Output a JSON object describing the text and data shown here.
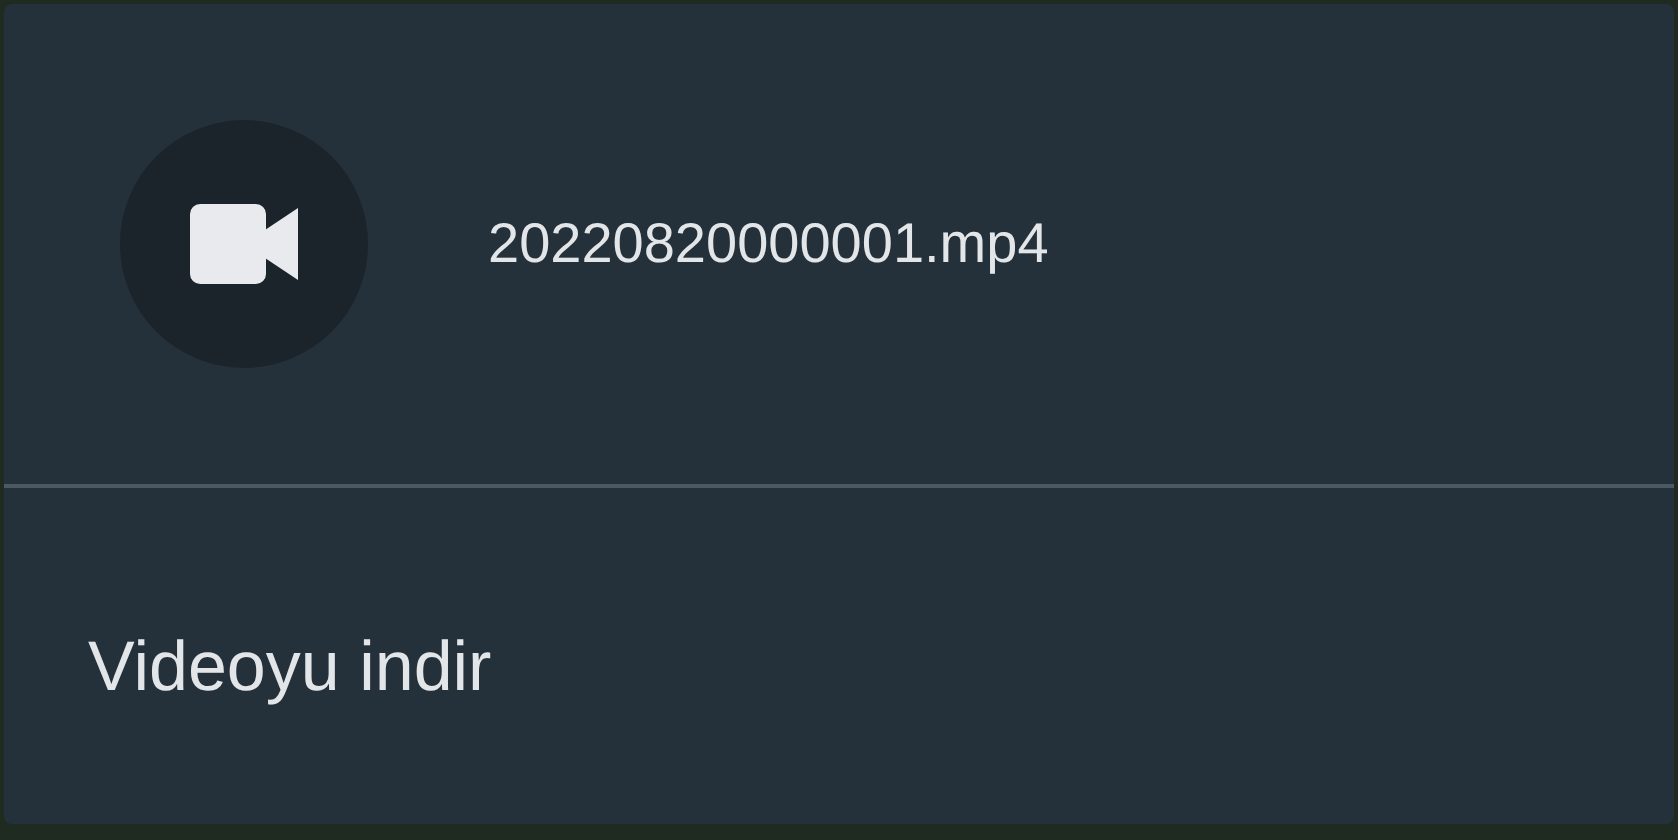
{
  "file": {
    "name": "20220820000001.mp4"
  },
  "actions": [
    {
      "label": "Videoyu indir"
    }
  ]
}
